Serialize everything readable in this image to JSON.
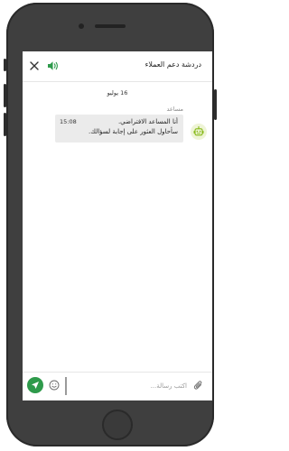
{
  "header": {
    "title": "دردشة دعم العملاء",
    "close_icon": "close-icon",
    "sound_icon": "speaker-icon"
  },
  "conversation": {
    "date_separator": "16 يوليو",
    "messages": [
      {
        "sender": "مساعد",
        "avatar_icon": "robot-icon",
        "time": "15:08",
        "lines": [
          "أنا المساعد الافتراضي.",
          "سأحاول العثور على إجابة لسؤالك."
        ]
      }
    ]
  },
  "composer": {
    "placeholder": "اكتب رسالة...",
    "send_icon": "send-icon",
    "emoji_icon": "emoji-icon",
    "attach_icon": "paperclip-icon"
  },
  "colors": {
    "accent": "#2e9a4b",
    "bubble": "#ebebeb",
    "avatar_bg": "#eef4d6",
    "device": "#3f3f3f"
  }
}
